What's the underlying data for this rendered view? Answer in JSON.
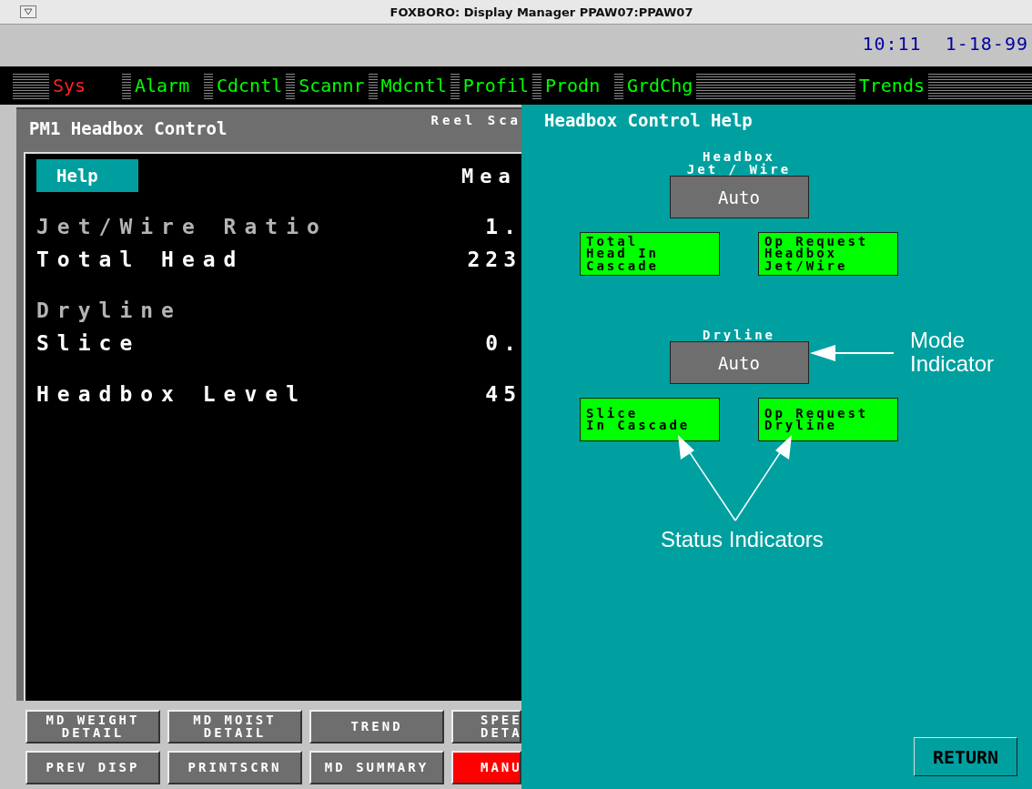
{
  "window": {
    "title": "FOXBORO: Display Manager  PPAW07:PPAW07"
  },
  "clock": "10:11  1-18-99",
  "menu": [
    {
      "label": "Sys",
      "alarmed": true
    },
    {
      "label": "Alarm",
      "alarmed": false
    },
    {
      "label": "Cdcntl",
      "alarmed": false
    },
    {
      "label": "Scannr",
      "alarmed": false
    },
    {
      "label": "Mdcntl",
      "alarmed": false
    },
    {
      "label": "Profil",
      "alarmed": false
    },
    {
      "label": "Prodn",
      "alarmed": false
    },
    {
      "label": "GrdChg",
      "alarmed": false
    },
    {
      "label": "Trends",
      "alarmed": false
    }
  ],
  "display": {
    "title": "PM1 Headbox Control",
    "header_right": "Reel Sca",
    "help_button": "Help",
    "column_heading": "Mea",
    "groups": [
      [
        {
          "label": "Jet/Wire Ratio",
          "value": "1.",
          "dimmed": true
        },
        {
          "label": "Total Head",
          "value": "223",
          "dimmed": false
        }
      ],
      [
        {
          "label": "Dryline",
          "dimmed": true
        },
        {
          "label": "Slice",
          "value": "0.",
          "dimmed": false
        }
      ],
      [
        {
          "label": "Headbox Level",
          "value": "45",
          "dimmed": false
        }
      ]
    ]
  },
  "buttons": [
    [
      {
        "lines": [
          "MD WEIGHT",
          "DETAIL"
        ],
        "color": "#6e6e6e"
      },
      {
        "lines": [
          "MD MOIST",
          "DETAIL"
        ],
        "color": "#6e6e6e"
      },
      {
        "lines": [
          "TREND"
        ],
        "color": "#6e6e6e"
      },
      {
        "lines": [
          "SPEE",
          "DETA"
        ],
        "color": "#6e6e6e"
      }
    ],
    [
      {
        "lines": [
          "PREV DISP"
        ],
        "color": "#6e6e6e"
      },
      {
        "lines": [
          "PRINTSCRN"
        ],
        "color": "#6e6e6e"
      },
      {
        "lines": [
          "MD SUMMARY"
        ],
        "color": "#6e6e6e"
      },
      {
        "lines": [
          "MANU"
        ],
        "color": "#ff0000"
      }
    ]
  ],
  "help": {
    "title": "Headbox Control Help",
    "sections": [
      {
        "label_lines": [
          "Headbox",
          "Jet / Wire"
        ],
        "mode": "Auto",
        "status": [
          {
            "lines": [
              "Total",
              "Head In",
              "Cascade"
            ]
          },
          {
            "lines": [
              "Op Request",
              "Headbox",
              "Jet/Wire"
            ]
          }
        ]
      },
      {
        "label_lines": [
          "Dryline"
        ],
        "mode": "Auto",
        "status": [
          {
            "lines": [
              "Slice",
              "In Cascade"
            ]
          },
          {
            "lines": [
              "Op Request",
              "Dryline"
            ]
          }
        ]
      }
    ],
    "mode_indicator": [
      "Mode",
      "Indicator"
    ],
    "status_indicators": "Status Indicators",
    "return_button": "RETURN"
  }
}
